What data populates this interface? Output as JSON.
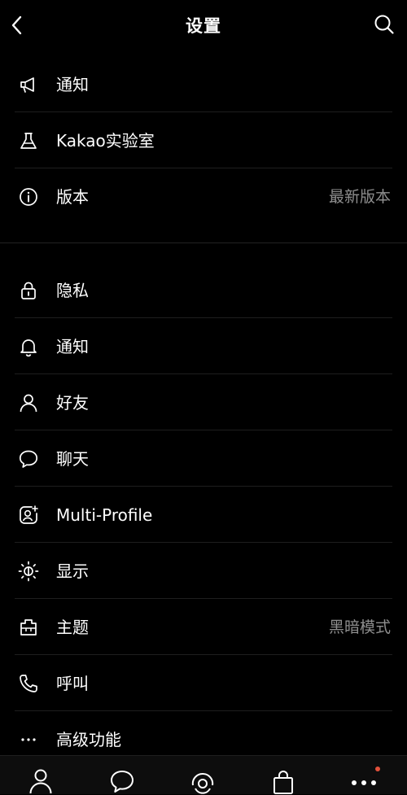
{
  "header": {
    "title": "设置"
  },
  "group1": [
    {
      "label": "通知",
      "icon": "megaphone-icon"
    },
    {
      "label": "Kakao实验室",
      "icon": "flask-icon"
    },
    {
      "label": "版本",
      "icon": "info-icon",
      "value": "最新版本"
    }
  ],
  "group2": [
    {
      "label": "隐私",
      "icon": "lock-icon"
    },
    {
      "label": "通知",
      "icon": "bell-icon"
    },
    {
      "label": "好友",
      "icon": "person-icon"
    },
    {
      "label": "聊天",
      "icon": "chat-bubble-icon"
    },
    {
      "label": "Multi-Profile",
      "icon": "multi-profile-icon"
    },
    {
      "label": "显示",
      "icon": "brightness-icon"
    },
    {
      "label": "主题",
      "icon": "theme-icon",
      "value": "黑暗模式"
    },
    {
      "label": "呼叫",
      "icon": "phone-icon"
    },
    {
      "label": "高级功能",
      "icon": "more-dots-icon"
    }
  ],
  "tabbar": {
    "tabs": [
      "friends-tab",
      "chats-tab",
      "view-tab",
      "shopping-tab",
      "more-tab"
    ],
    "badge_color": "#e2513b"
  },
  "colors": {
    "background": "#000000",
    "text": "#ffffff",
    "secondary_text": "#8e8e8e"
  }
}
